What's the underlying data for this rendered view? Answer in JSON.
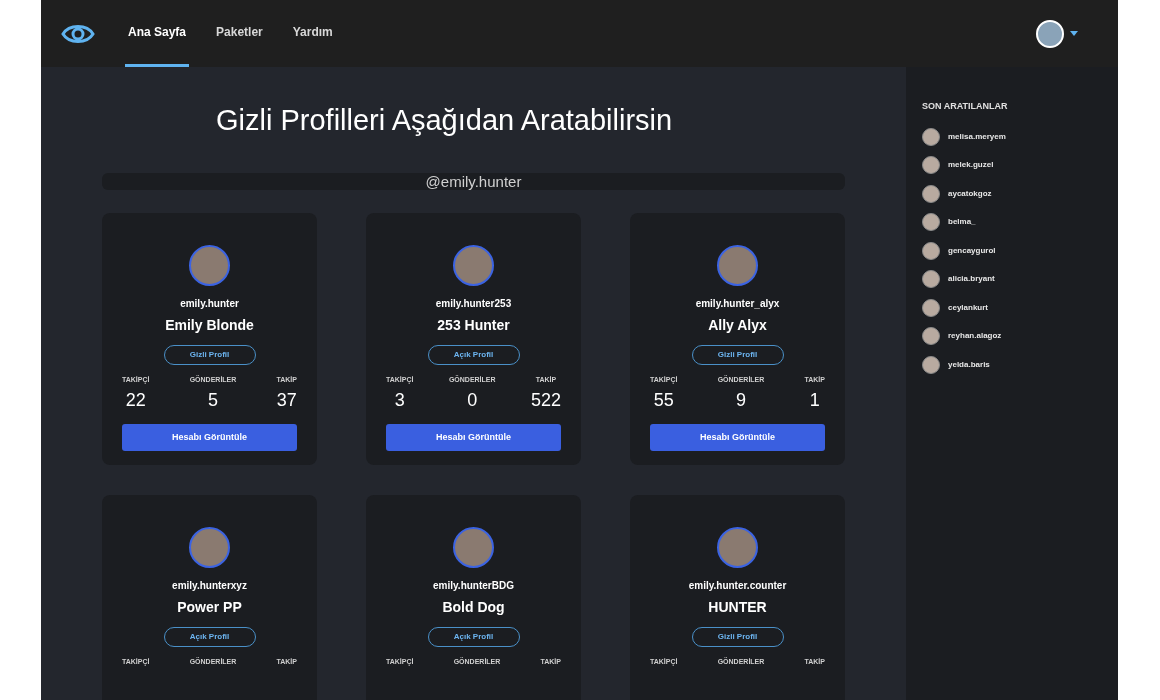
{
  "nav": {
    "items": [
      {
        "label": "Ana Sayfa",
        "selected": true
      },
      {
        "label": "Paketler",
        "selected": false
      },
      {
        "label": "Yardım",
        "selected": false
      }
    ]
  },
  "heading": "Gizli Profilleri Aşağıdan Aratabilirsin",
  "search": {
    "value": "@emily.hunter"
  },
  "profiles": [
    {
      "username": "emily.hunter",
      "name": "Emily Blonde",
      "status": "Gizli Profil",
      "stats": [
        {
          "label": "TAKİPÇİ",
          "value": "22"
        },
        {
          "label": "GÖNDERİLER",
          "value": "5"
        },
        {
          "label": "TAKİP",
          "value": "37"
        }
      ],
      "button": "Hesabı Görüntüle"
    },
    {
      "username": "emily.hunter253",
      "name": "253 Hunter",
      "status": "Açık Profil",
      "stats": [
        {
          "label": "TAKİPÇİ",
          "value": "3"
        },
        {
          "label": "GÖNDERİLER",
          "value": "0"
        },
        {
          "label": "TAKİP",
          "value": "522"
        }
      ],
      "button": "Hesabı Görüntüle"
    },
    {
      "username": "emily.hunter_alyx",
      "name": "Ally Alyx",
      "status": "Gizli Profil",
      "stats": [
        {
          "label": "TAKİPÇİ",
          "value": "55"
        },
        {
          "label": "GÖNDERİLER",
          "value": "9"
        },
        {
          "label": "TAKİP",
          "value": "1"
        }
      ],
      "button": "Hesabı Görüntüle"
    },
    {
      "username": "emily.hunterxyz",
      "name": "Power PP",
      "status": "Açık Profil",
      "stats": [
        {
          "label": "TAKİPÇİ"
        },
        {
          "label": "GÖNDERİLER"
        },
        {
          "label": "TAKİP"
        }
      ]
    },
    {
      "username": "emily.hunterBDG",
      "name": "Bold Dog",
      "status": "Açık Profil",
      "stats": [
        {
          "label": "TAKİPÇİ"
        },
        {
          "label": "GÖNDERİLER"
        },
        {
          "label": "TAKİP"
        }
      ]
    },
    {
      "username": "emily.hunter.counter",
      "name": "HUNTER",
      "status": "Gizli Profil",
      "stats": [
        {
          "label": "TAKİPÇİ"
        },
        {
          "label": "GÖNDERİLER"
        },
        {
          "label": "TAKİP"
        }
      ]
    }
  ],
  "recent": {
    "title": "SON ARATILANLAR",
    "items": [
      "melisa.meryem",
      "melek.guzel",
      "aycatokgoz",
      "belma_",
      "gencaygurol",
      "alicia.bryant",
      "ceylankurt",
      "reyhan.alagoz",
      "yelda.baris"
    ]
  }
}
